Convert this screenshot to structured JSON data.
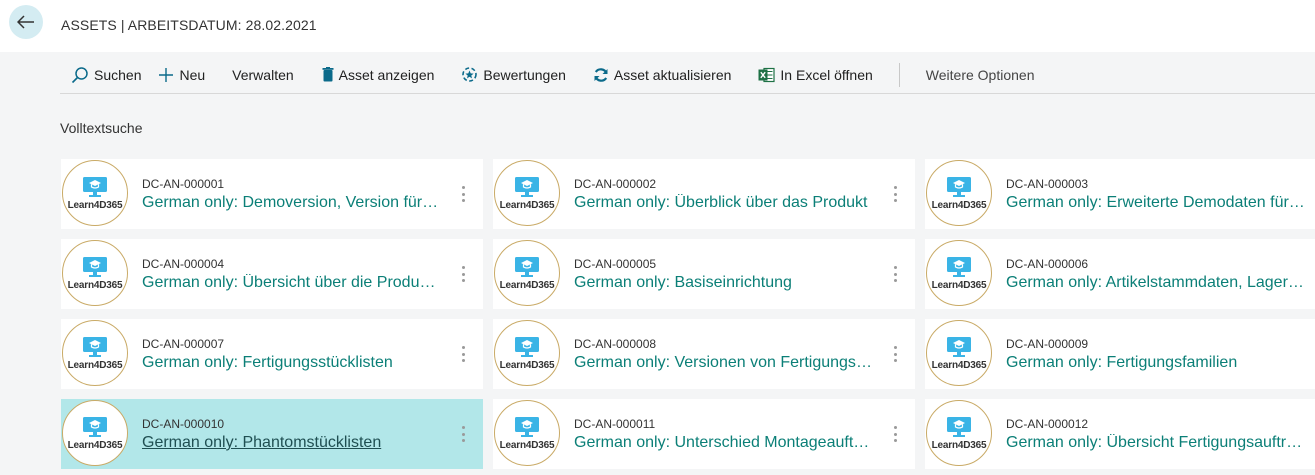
{
  "header": {
    "title": "ASSETS | ARBEITSDATUM: 28.02.2021"
  },
  "actions": [
    {
      "label": "Suchen",
      "icon": "search-icon"
    },
    {
      "label": "Neu",
      "icon": "plus-icon"
    },
    {
      "label": "Verwalten",
      "icon": ""
    },
    {
      "label": "Asset anzeigen",
      "icon": "trash-icon"
    },
    {
      "label": "Bewertungen",
      "icon": "rating-icon"
    },
    {
      "label": "Asset aktualisieren",
      "icon": "refresh-icon"
    },
    {
      "label": "In Excel öffnen",
      "icon": "excel-icon"
    }
  ],
  "more_options": "Weitere Optionen",
  "section_label": "Volltextsuche",
  "logo_text": "Learn4D365",
  "colors": {
    "accent": "#0b7f77",
    "selected": "#b2e7e9",
    "back": "#d4ecf2"
  },
  "tiles": [
    {
      "code": "DC-AN-000001",
      "title": "German only: Demoversion, Version für Evaluierung"
    },
    {
      "code": "DC-AN-000002",
      "title": "German only: Überblick über das Produkt"
    },
    {
      "code": "DC-AN-000003",
      "title": "German only: Erweiterte Demodaten für Fertigung"
    },
    {
      "code": "DC-AN-000004",
      "title": "German only: Übersicht über die Produktion"
    },
    {
      "code": "DC-AN-000005",
      "title": "German only: Basiseinrichtung"
    },
    {
      "code": "DC-AN-000006",
      "title": "German only: Artikelstammdaten, Lagerhaltung"
    },
    {
      "code": "DC-AN-000007",
      "title": "German only: Fertigungsstücklisten"
    },
    {
      "code": "DC-AN-000008",
      "title": "German only: Versionen von Fertigungsstücklisten"
    },
    {
      "code": "DC-AN-000009",
      "title": "German only: Fertigungsfamilien"
    },
    {
      "code": "DC-AN-000010",
      "title": "German only: Phantomstücklisten",
      "selected": true
    },
    {
      "code": "DC-AN-000011",
      "title": "German only: Unterschied Montageaufträge"
    },
    {
      "code": "DC-AN-000012",
      "title": "German only: Übersicht Fertigungsaufträge"
    }
  ]
}
